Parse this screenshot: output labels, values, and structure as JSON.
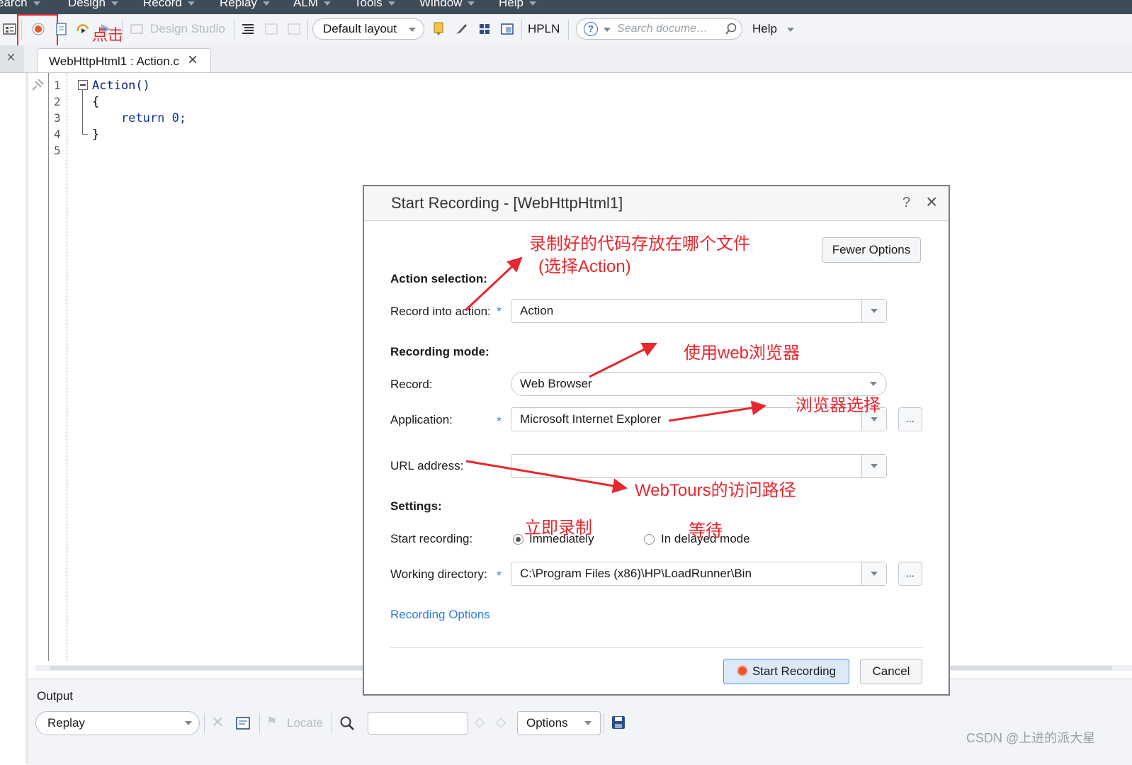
{
  "menu": [
    {
      "label": "earch"
    },
    {
      "label": "Design"
    },
    {
      "label": "Record"
    },
    {
      "label": "Replay"
    },
    {
      "label": "ALM"
    },
    {
      "label": "Tools"
    },
    {
      "label": "Window"
    },
    {
      "label": "Help"
    }
  ],
  "toolbar": {
    "design_studio": "Design Studio",
    "layout": "Default layout",
    "hpln": "HPLN",
    "search_placeholder": "Search docume…",
    "help": "Help"
  },
  "tab": {
    "title": "WebHttpHtml1 : Action.c"
  },
  "editor": {
    "line_numbers": [
      "1",
      "2",
      "3",
      "4",
      "5"
    ],
    "lines": [
      "Action()",
      "{",
      "    return 0;",
      "}",
      ""
    ]
  },
  "output": {
    "title": "Output",
    "source": "Replay",
    "locate": "Locate",
    "options": "Options"
  },
  "dialog": {
    "title": "Start Recording - [WebHttpHtml1]",
    "help": "?",
    "fewer_options": "Fewer Options",
    "action_selection": "Action selection:",
    "record_into_action_label": "Record into action:",
    "record_into_action_value": "Action",
    "recording_mode": "Recording mode:",
    "record_label": "Record:",
    "record_value": "Web Browser",
    "application_label": "Application:",
    "application_value": "Microsoft Internet Explorer",
    "url_label": "URL address:",
    "url_value": "",
    "settings": "Settings:",
    "start_recording_label": "Start recording:",
    "immediately": "Immediately",
    "delayed": "In delayed mode",
    "working_dir_label": "Working directory:",
    "working_dir_value": "C:\\Program Files (x86)\\HP\\LoadRunner\\Bin",
    "recording_options": "Recording Options",
    "start_button": "Start Recording",
    "cancel_button": "Cancel",
    "ellipsis": "..."
  },
  "annotations": {
    "click": "点击",
    "file_note_1": "录制好的代码存放在哪个文件",
    "file_note_2": "(选择Action)",
    "web_browser": "使用web浏览器",
    "browser_select": "浏览器选择",
    "webtours_path": "WebTours的访问路径",
    "immediate": "立即录制",
    "wait": "等待"
  },
  "watermark": "CSDN @上进的派大星",
  "colors": {
    "annotation": "#e8262d",
    "link": "#2f7cd6",
    "accent_blue": "#3a8de0"
  }
}
